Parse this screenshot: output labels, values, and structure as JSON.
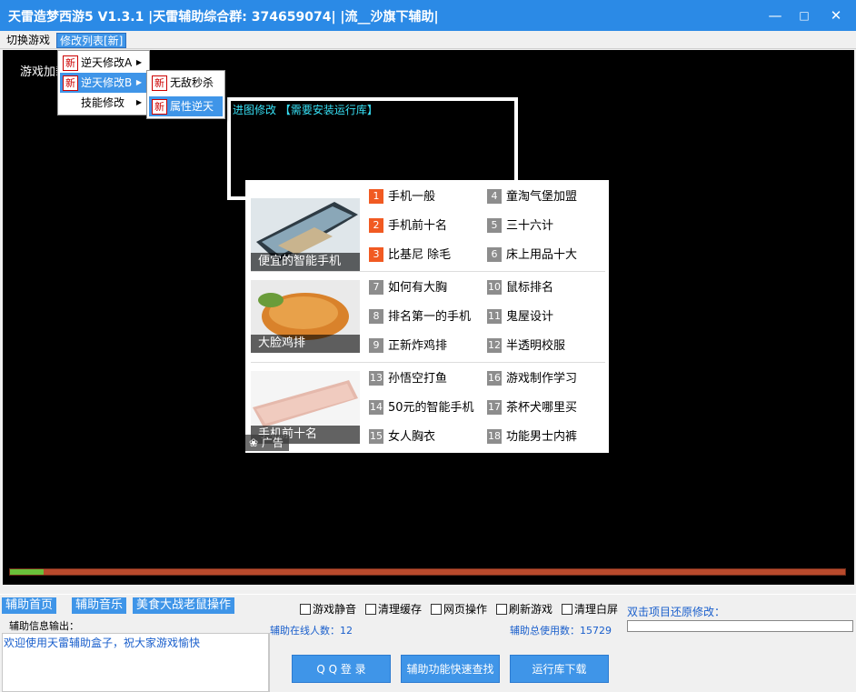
{
  "titlebar": {
    "title": "天雷造梦西游5 V1.3.1   |天雷辅助综合群:  374659074|   |流__沙旗下辅助|",
    "min": "—",
    "max": "□",
    "close": "✕"
  },
  "menu": {
    "switch_game": "切换游戏",
    "mod_list": "修改列表[新]"
  },
  "game": {
    "loading_text": "游戏加载中"
  },
  "submenu1": {
    "badge": "新",
    "items": [
      "逆天修改A",
      "逆天修改B",
      "技能修改"
    ]
  },
  "submenu2": {
    "badge": "新",
    "items": [
      "无敌秒杀",
      "属性逆天"
    ]
  },
  "dialog": {
    "text": "进图修改 【需要安装运行库】"
  },
  "ad": {
    "tag": "广告",
    "images": [
      "便宜的智能手机",
      "大脸鸡排",
      "手机前十名"
    ],
    "left_col": [
      {
        "n": "1",
        "t": "手机一般"
      },
      {
        "n": "2",
        "t": "手机前十名"
      },
      {
        "n": "3",
        "t": "比基尼 除毛"
      },
      {
        "n": "7",
        "t": "如何有大胸"
      },
      {
        "n": "8",
        "t": "排名第一的手机"
      },
      {
        "n": "9",
        "t": "正新炸鸡排"
      },
      {
        "n": "13",
        "t": "孙悟空打鱼"
      },
      {
        "n": "14",
        "t": "50元的智能手机"
      },
      {
        "n": "15",
        "t": "女人胸衣"
      }
    ],
    "right_col": [
      {
        "n": "4",
        "t": "童淘气堡加盟"
      },
      {
        "n": "5",
        "t": "三十六计"
      },
      {
        "n": "6",
        "t": "床上用品十大"
      },
      {
        "n": "10",
        "t": "鼠标排名"
      },
      {
        "n": "11",
        "t": "鬼屋设计"
      },
      {
        "n": "12",
        "t": "半透明校服"
      },
      {
        "n": "16",
        "t": "游戏制作学习"
      },
      {
        "n": "17",
        "t": "茶杯犬哪里买"
      },
      {
        "n": "18",
        "t": "功能男士内裤"
      }
    ]
  },
  "progress": {
    "fraction": 0.04
  },
  "bottom": {
    "tabs": [
      "辅助首页",
      "辅助音乐",
      "美食大战老鼠操作"
    ],
    "checkboxes": [
      "游戏静音",
      "清理缓存",
      "网页操作",
      "刷新游戏",
      "清理白屏"
    ],
    "restore_label": "双击项目还原修改：",
    "info_label": "辅助信息输出：",
    "online_label": "辅助在线人数：12",
    "total_label": "辅助总使用数：15729",
    "welcome": "欢迎使用天雷辅助盒子，祝大家游戏愉快",
    "buttons": [
      "Q Q 登 录",
      "辅助功能快速查找",
      "运行库下载"
    ]
  }
}
